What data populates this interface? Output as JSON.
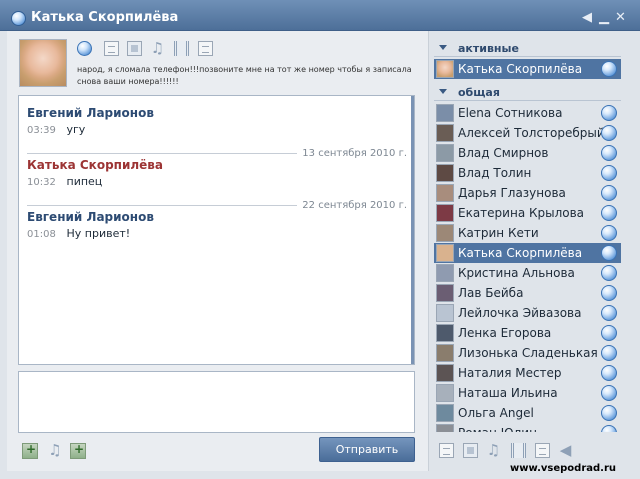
{
  "window": {
    "title": "Катька Скорпилёва",
    "minimize_glyph": "▁",
    "sound_glyph": "◀",
    "close_glyph": "✕"
  },
  "profile": {
    "status_message": "народ, я сломала телефон!!!позвоните мне на тот же номер чтобы я записала снова ваши номера!!!!!!"
  },
  "chat": {
    "messages": [
      {
        "author": "Евгений Ларионов",
        "time": "03:39",
        "text": "угу"
      },
      {
        "date": "13 сентября 2010 г.",
        "author": "Катька Скорпилёва",
        "time": "10:32",
        "text": "пипец"
      },
      {
        "date": "22 сентября 2010 г.",
        "author": "Евгений Ларионов",
        "time": "01:08",
        "text": "Ну привет!"
      }
    ]
  },
  "compose": {
    "send_label": "Отправить"
  },
  "contacts": {
    "active_header": "активные",
    "general_header": "общая",
    "active": {
      "name": "Катька Скорпилёва"
    },
    "list": [
      {
        "name": "Elena Сотникова"
      },
      {
        "name": "Алексей Толсторебрый"
      },
      {
        "name": "Влад Смирнов"
      },
      {
        "name": "Влад Толин"
      },
      {
        "name": "Дарья Глазунова"
      },
      {
        "name": "Екатерина Крылова"
      },
      {
        "name": "Катрин Кети"
      },
      {
        "name": "Катька Скорпилёва",
        "selected": true
      },
      {
        "name": "Кристина Альнова"
      },
      {
        "name": "Лав Бейба"
      },
      {
        "name": "Лейлочка Эйвазова"
      },
      {
        "name": "Ленка Егорова"
      },
      {
        "name": "Лизонька Сладенькая"
      },
      {
        "name": "Наталия Местер"
      },
      {
        "name": "Наташа Ильина"
      },
      {
        "name": "Ольга Angel"
      },
      {
        "name": "Роман Юлин"
      }
    ]
  },
  "watermark": "www.vsepodrad.ru",
  "colors": {
    "accent": "#4f74a2",
    "title_bar": "#5b7ca5",
    "author_self": "#2d4b73",
    "author_other": "#9c3434"
  }
}
